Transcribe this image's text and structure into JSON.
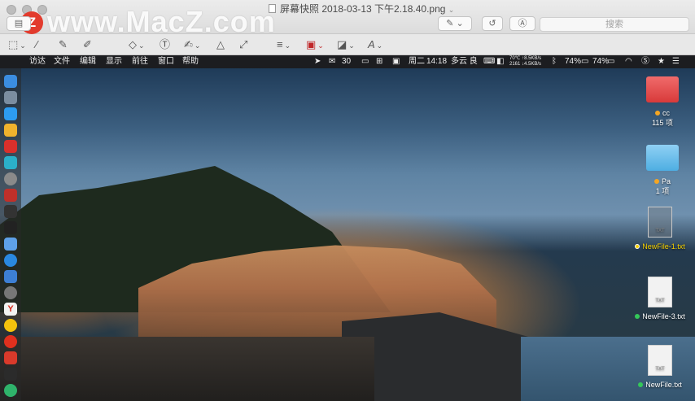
{
  "window": {
    "app_badge": "Z",
    "watermark": "www.MacZ.com",
    "document_title": "屏幕快照 2018-03-13 下午2.18.40.png",
    "search_placeholder": "搜索"
  },
  "menubar": {
    "items": [
      "访达",
      "文件",
      "编辑",
      "显示",
      "前往",
      "窗口",
      "帮助"
    ],
    "status": {
      "wechat_count": "30",
      "date": "周二",
      "time": "14:18",
      "weather": "多云 良",
      "temp": "70℃",
      "net_up": "↑8.5KB/s",
      "cpu": "2161",
      "net_down": "↓4.5KB/s",
      "battery_1": "74%",
      "battery_2": "74%"
    }
  },
  "desktop": {
    "icons": [
      {
        "label": "cc",
        "sub": "115 项",
        "kind": "folder-red",
        "dot_color": "#f5a623"
      },
      {
        "label": "Pa",
        "sub": "1 项",
        "kind": "folder-blue",
        "dot_color": "#f5a623"
      },
      {
        "label": "NewFile-1.txt",
        "sub": "TXT",
        "kind": "txt",
        "dot_color": "#f5d000"
      },
      {
        "label": "NewFile-3.txt",
        "sub": "TXT",
        "kind": "txt",
        "dot_color": "#34c759"
      },
      {
        "label": "NewFile.txt",
        "sub": "TXT",
        "kind": "txt",
        "dot_color": "#34c759"
      }
    ]
  }
}
